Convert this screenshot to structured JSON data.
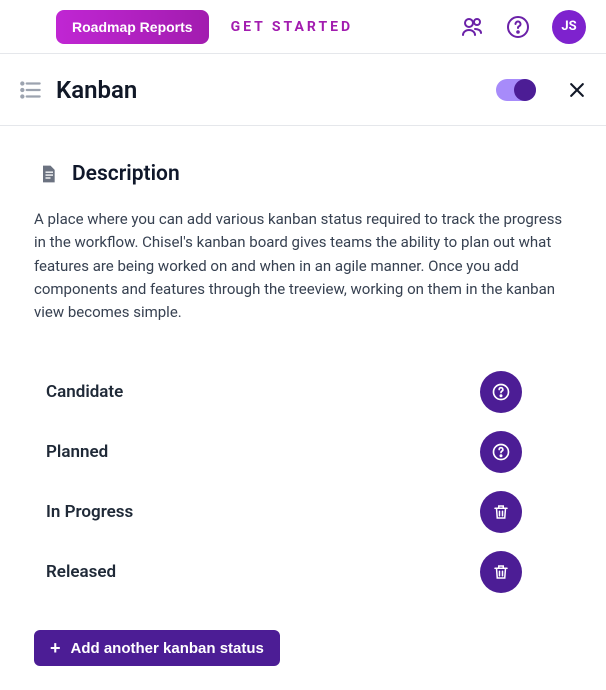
{
  "topbar": {
    "roadmap_label": "Roadmap Reports",
    "get_started_label": "GET STARTED",
    "avatar_initials": "JS"
  },
  "subheader": {
    "title": "Kanban",
    "toggle_on": true
  },
  "section": {
    "title": "Description",
    "body": "A place where you can add various kanban status required to track the progress in the workflow. Chisel's kanban board gives teams the ability to plan out what features are being worked on and when in an agile manner. Once you add components and features through the treeview, working on them in the kanban view becomes simple."
  },
  "statuses": [
    {
      "label": "Candidate",
      "action": "help"
    },
    {
      "label": "Planned",
      "action": "help"
    },
    {
      "label": "In Progress",
      "action": "delete"
    },
    {
      "label": "Released",
      "action": "delete"
    }
  ],
  "add_button_label": "Add another kanban status",
  "colors": {
    "accent_dark": "#4c1d95",
    "accent_gradient_start": "#c026d3",
    "accent_gradient_end": "#a21caf",
    "toggle_track": "#a78bfa"
  }
}
